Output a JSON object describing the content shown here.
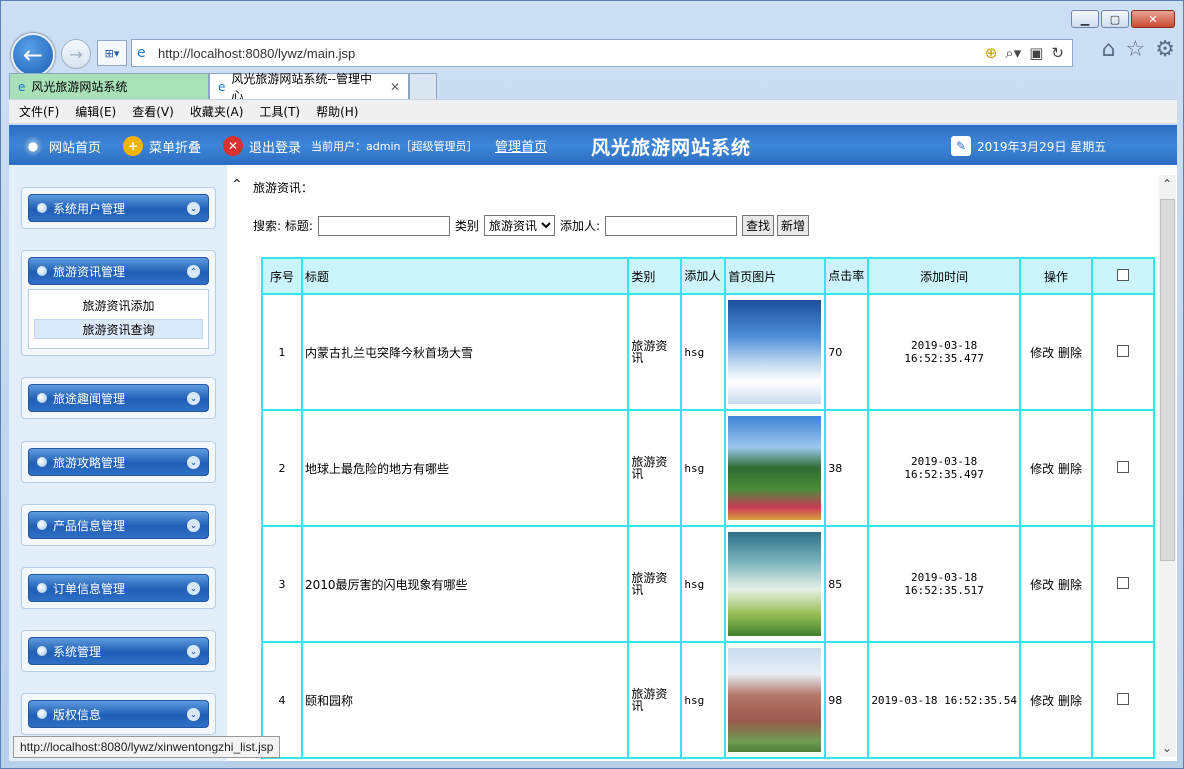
{
  "browser": {
    "url": "http://localhost:8080/lywz/main.jsp",
    "tabs": [
      {
        "label": "风光旅游网站系统"
      },
      {
        "label": "风光旅游网站系统--管理中心"
      }
    ],
    "menu": [
      "文件(F)",
      "编辑(E)",
      "查看(V)",
      "收藏夹(A)",
      "工具(T)",
      "帮助(H)"
    ],
    "status_url": "http://localhost:8080/lywz/xinwentongzhi_list.jsp"
  },
  "header": {
    "home": "网站首页",
    "collapse": "菜单折叠",
    "logout": "退出登录",
    "current_user": "当前用户：admin［超级管理员］",
    "admin_home": "管理首页",
    "title": "风光旅游网站系统",
    "date": "2019年3月29日 星期五"
  },
  "sidebar": {
    "groups": [
      {
        "label": "系统用户管理"
      },
      {
        "label": "旅游资讯管理",
        "items": [
          "旅游资讯添加",
          "旅游资讯查询"
        ]
      },
      {
        "label": "旅途趣闻管理"
      },
      {
        "label": "旅游攻略管理"
      },
      {
        "label": "产品信息管理"
      },
      {
        "label": "订单信息管理"
      },
      {
        "label": "系统管理"
      },
      {
        "label": "版权信息"
      }
    ]
  },
  "main": {
    "crumb": "旅游资讯：",
    "search": {
      "prefix": "搜索:",
      "title_label": "标题:",
      "category_label": "类别",
      "category_value": "旅游资讯",
      "adder_label": "添加人:",
      "find_btn": "查找",
      "add_btn": "新增"
    },
    "columns": [
      "序号",
      "标题",
      "类别",
      "添加人",
      "首页图片",
      "点击率",
      "添加时间",
      "操作"
    ],
    "rows": [
      {
        "no": "1",
        "title": "内蒙古扎兰屯突降今秋首场大雪",
        "category": "旅游资讯",
        "adder": "hsg",
        "clicks": "70",
        "time": "2019-03-18 16:52:35.477",
        "image": "sky-clouds"
      },
      {
        "no": "2",
        "title": "地球上最危险的地方有哪些",
        "category": "旅游资讯",
        "adder": "hsg",
        "clicks": "38",
        "time": "2019-03-18 16:52:35.497",
        "image": "windmill-garden"
      },
      {
        "no": "3",
        "title": "2010最厉害的闪电现象有哪些",
        "category": "旅游资讯",
        "adder": "hsg",
        "clicks": "85",
        "time": "2019-03-18 16:52:35.517",
        "image": "balloon-field"
      },
      {
        "no": "4",
        "title": "颐和园称",
        "category": "旅游资讯",
        "adder": "hsg",
        "clicks": "98",
        "time": "2019-03-18 16:52:35.54",
        "image": "campus-buildings"
      }
    ],
    "actions": {
      "edit": "修改",
      "delete": "删除"
    }
  }
}
